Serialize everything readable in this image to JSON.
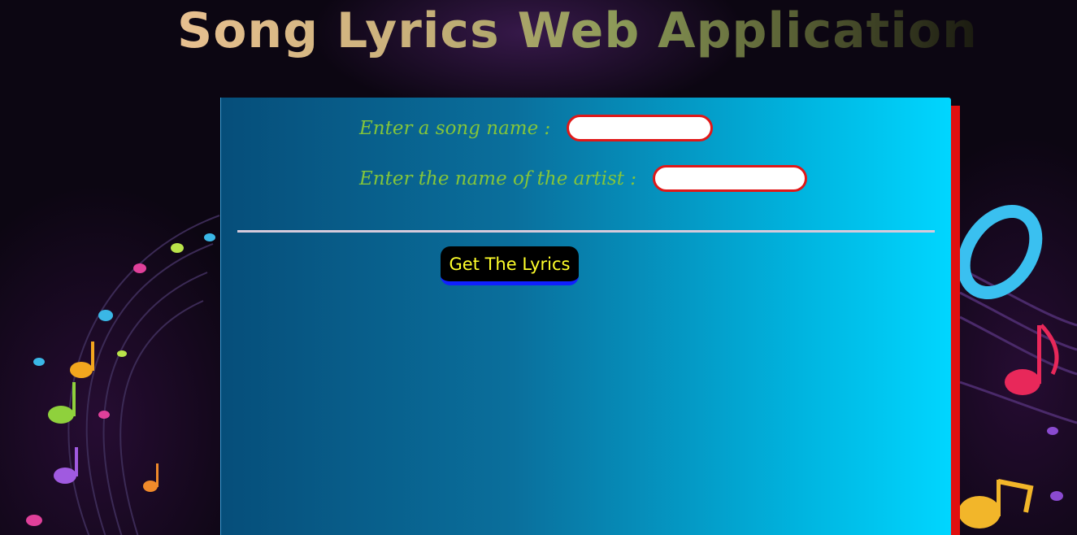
{
  "header": {
    "title": "Song Lyrics Web Application"
  },
  "form": {
    "song_label": "Enter a song name :",
    "song_value": "",
    "artist_label": "Enter the name of the artist :",
    "artist_value": "",
    "submit_label": "Get The Lyrics"
  },
  "colors": {
    "label": "#84c53a",
    "input_border": "#e01818",
    "button_bg": "#000000",
    "button_text": "#ffff2a",
    "button_underline": "#1020ff",
    "panel_accent": "#e01010"
  },
  "icons": [
    "music-notes-left-decoration",
    "music-notes-right-decoration"
  ]
}
